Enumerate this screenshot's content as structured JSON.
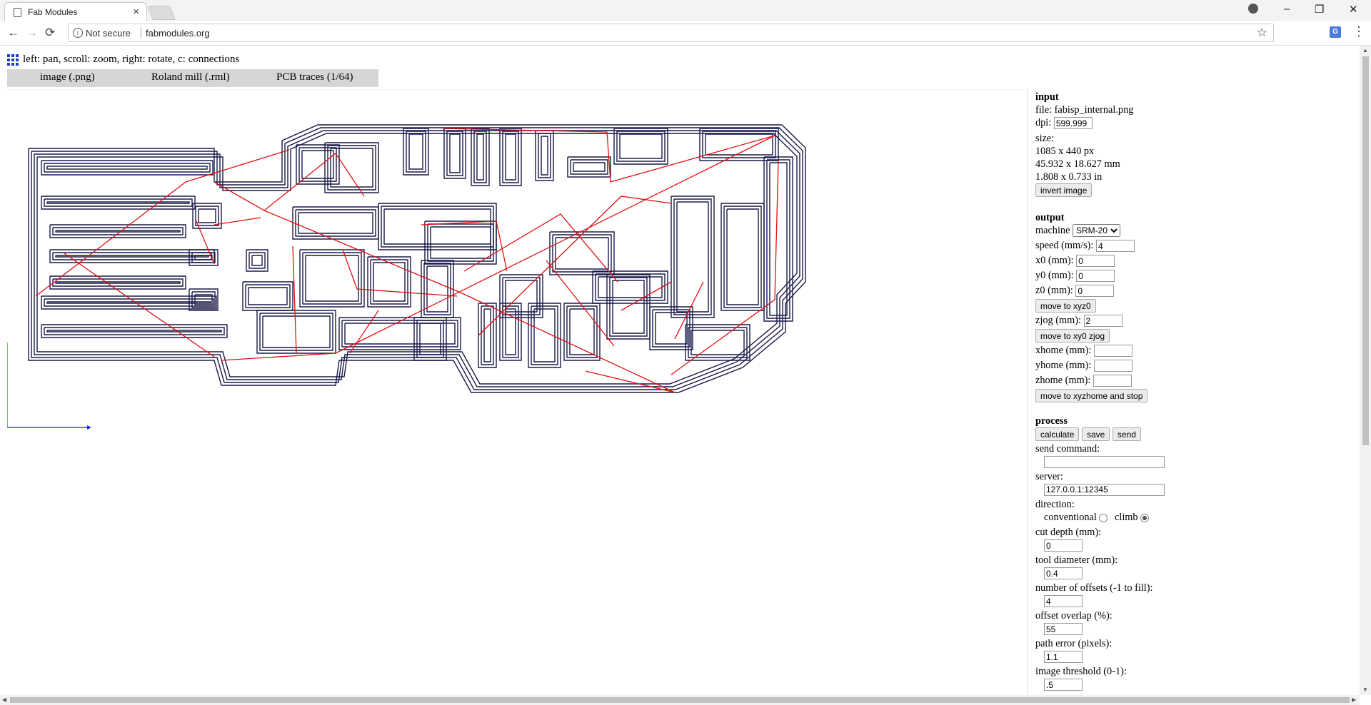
{
  "browser": {
    "tab_title": "Fab Modules",
    "tab_close": "×",
    "security_label": "Not secure",
    "url": "fabmodules.org",
    "window_minimize": "–",
    "window_restore": "❐",
    "window_close": "✕",
    "back": "←",
    "forward": "→",
    "reload": "⟳",
    "star": "☆",
    "menu": "⋮"
  },
  "page": {
    "instructions": "left: pan, scroll: zoom, right: rotate, c: connections",
    "tabs": [
      {
        "label": "image (.png)"
      },
      {
        "label": "Roland mill (.rml)"
      },
      {
        "label": "PCB traces (1/64)"
      }
    ]
  },
  "panel": {
    "input": {
      "heading": "input",
      "file_label": "file: fabisp_internal.png",
      "dpi_label": "dpi:",
      "dpi_value": "599.999",
      "size_label": "size:",
      "size_px": "1085 x 440 px",
      "size_mm": "45.932 x 18.627 mm",
      "size_in": "1.808 x 0.733 in",
      "invert_button": "invert image"
    },
    "output": {
      "heading": "output",
      "machine_label": "machine",
      "machine_value": "SRM-20",
      "speed_label": "speed (mm/s):",
      "speed_value": "4",
      "x0_label": "x0 (mm):",
      "x0_value": "0",
      "y0_label": "y0 (mm):",
      "y0_value": "0",
      "z0_label": "z0 (mm):",
      "z0_value": "0",
      "move_xyz0_button": "move to xyz0",
      "zjog_label": "zjog (mm):",
      "zjog_value": "2",
      "move_xy0_button": "move to xy0 zjog",
      "xhome_label": "xhome (mm):",
      "xhome_value": "",
      "yhome_label": "yhome (mm):",
      "yhome_value": "",
      "zhome_label": "zhome (mm):",
      "zhome_value": "",
      "move_home_button": "move to xyzhome and stop"
    },
    "process": {
      "heading": "process",
      "calculate_button": "calculate",
      "save_button": "save",
      "send_button": "send",
      "send_command_label": "send command:",
      "send_command_value": "",
      "server_label": "server:",
      "server_value": "127.0.0.1:12345",
      "direction_label": "direction:",
      "conventional_label": "conventional",
      "climb_label": "climb",
      "direction_selected": "climb",
      "cut_depth_label": "cut depth (mm):",
      "cut_depth_value": "0",
      "tool_diameter_label": "tool diameter (mm):",
      "tool_diameter_value": "0.4",
      "offsets_label": "number of offsets (-1 to fill):",
      "offsets_value": "4",
      "overlap_label": "offset overlap (%):",
      "overlap_value": "55",
      "path_error_label": "path error (pixels):",
      "path_error_value": "1.1",
      "threshold_label": "image threshold (0-1):",
      "threshold_value": ".5"
    }
  },
  "colors": {
    "toolpath": "#1a1a4a",
    "connection": "#e01010",
    "x_axis": "#1f1fff",
    "y_axis": "#11b811",
    "tab_bar": "#d6d6d6"
  },
  "icons": {
    "app": "grid-icon",
    "tab": "page-icon",
    "info": "info-icon",
    "bookmark": "star-icon",
    "translate": "translate-icon"
  }
}
